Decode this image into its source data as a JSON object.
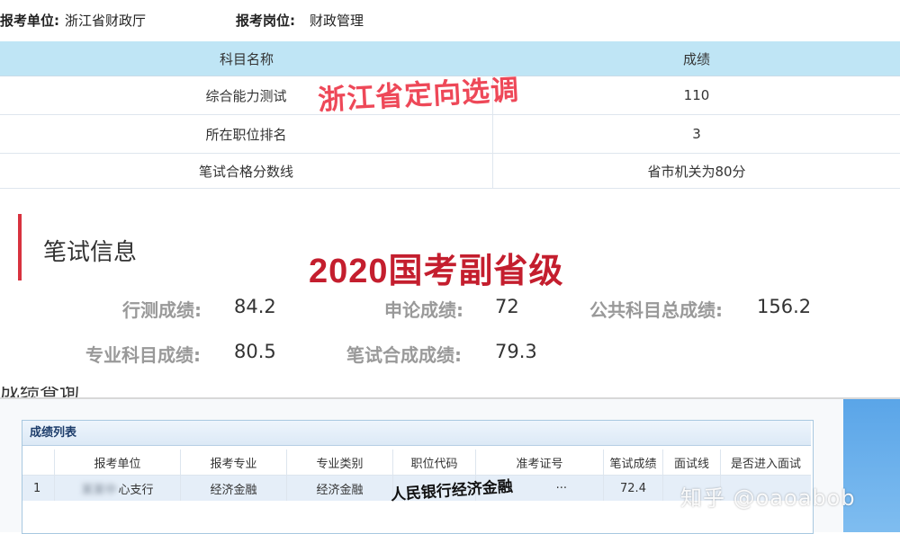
{
  "section1": {
    "unit_label": "报考单位:",
    "unit_value": "浙江省财政厅",
    "post_label": "报考岗位:",
    "post_value": "财政管理",
    "table": {
      "headers": [
        "科目名称",
        "成绩"
      ],
      "rows": [
        [
          "综合能力测试",
          "110"
        ],
        [
          "所在职位排名",
          "3"
        ],
        [
          "笔试合格分数线",
          "省市机关为80分"
        ]
      ]
    },
    "overlay": "浙江省定向选调"
  },
  "section2": {
    "title": "笔试信息",
    "overlay": "2020国考副省级",
    "items": [
      {
        "label": "行测成绩:",
        "value": "84.2"
      },
      {
        "label": "申论成绩:",
        "value": "72"
      },
      {
        "label": "公共科目总成绩:",
        "value": "156.2"
      },
      {
        "label": "专业科目成绩:",
        "value": "80.5"
      },
      {
        "label": "笔试合成成绩:",
        "value": "79.3"
      }
    ],
    "cut_heading": "成绩查询"
  },
  "section3": {
    "panel_title": "成绩列表",
    "headers": [
      "",
      "报考单位",
      "报考专业",
      "专业类别",
      "职位代码",
      "准考证号",
      "笔试成绩",
      "面试线",
      "是否进入面试"
    ],
    "row": [
      "1",
      "心支行",
      "经济金融",
      "经济金融",
      "",
      "···",
      "72.4",
      "",
      ""
    ],
    "overlay": "人民银行经济金融",
    "watermark": "知乎 @oaoabob"
  },
  "colors": {
    "header_blue": "#bfe5f5",
    "overlay_red_light": "#ee4858",
    "overlay_red_dark": "#c41e2e",
    "accent_bar": "#d8323f"
  }
}
